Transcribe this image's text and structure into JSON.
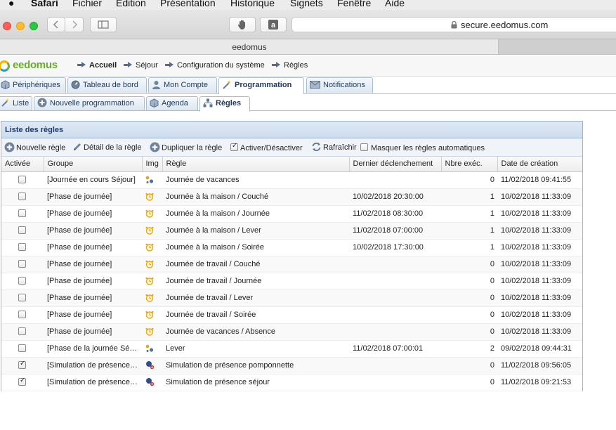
{
  "menubar": {
    "items": [
      "Safari",
      "Fichier",
      "Edition",
      "Présentation",
      "Historique",
      "Signets",
      "Fenêtre",
      "Aide"
    ]
  },
  "browser": {
    "url": "secure.eedomus.com",
    "tab_title": "eedomus"
  },
  "app": {
    "logo_text": "eedomus",
    "breadcrumb": [
      "Accueil",
      "Séjour",
      "Configuration du système",
      "Règles"
    ]
  },
  "main_tabs": [
    "Périphériques",
    "Tableau de bord",
    "Mon Compte",
    "Programmation",
    "Notifications"
  ],
  "sub_tabs": [
    "Liste",
    "Nouvelle programmation",
    "Agenda",
    "Règles"
  ],
  "panel": {
    "title": "Liste des règles",
    "tools": {
      "new_rule": "Nouvelle règle",
      "rule_detail": "Détail de la règle",
      "duplicate": "Dupliquer la règle",
      "activate": "Activer/Désactiver",
      "refresh": "Rafraîchir",
      "hide_auto": "Masquer les règles automatiques"
    },
    "columns": [
      "Activée",
      "Groupe",
      "Img",
      "Règle",
      "Dernier déclenchement",
      "Nbre exéc.",
      "Date de création"
    ],
    "rows": [
      {
        "active": false,
        "group": "[Journée en cours Séjour]",
        "icon": "rule-icon",
        "rule": "Journée de vacances",
        "last": "",
        "count": "0",
        "created": "11/02/2018 09:41:55"
      },
      {
        "active": false,
        "group": "[Phase de journée]",
        "icon": "alarm-clock-icon",
        "rule": "Journée à la maison / Couché",
        "last": "10/02/2018 20:30:00",
        "count": "1",
        "created": "10/02/2018 11:33:09"
      },
      {
        "active": false,
        "group": "[Phase de journée]",
        "icon": "alarm-clock-icon",
        "rule": "Journée à la maison / Journée",
        "last": "11/02/2018 08:30:00",
        "count": "1",
        "created": "10/02/2018 11:33:09"
      },
      {
        "active": false,
        "group": "[Phase de journée]",
        "icon": "alarm-clock-icon",
        "rule": "Journée à la maison / Lever",
        "last": "11/02/2018 07:00:00",
        "count": "1",
        "created": "10/02/2018 11:33:09"
      },
      {
        "active": false,
        "group": "[Phase de journée]",
        "icon": "alarm-clock-icon",
        "rule": "Journée à la maison / Soirée",
        "last": "10/02/2018 17:30:00",
        "count": "1",
        "created": "10/02/2018 11:33:09"
      },
      {
        "active": false,
        "group": "[Phase de journée]",
        "icon": "alarm-clock-icon",
        "rule": "Journée de travail / Couché",
        "last": "",
        "count": "0",
        "created": "10/02/2018 11:33:09"
      },
      {
        "active": false,
        "group": "[Phase de journée]",
        "icon": "alarm-clock-icon",
        "rule": "Journée de travail / Journée",
        "last": "",
        "count": "0",
        "created": "10/02/2018 11:33:09"
      },
      {
        "active": false,
        "group": "[Phase de journée]",
        "icon": "alarm-clock-icon",
        "rule": "Journée de travail / Lever",
        "last": "",
        "count": "0",
        "created": "10/02/2018 11:33:09"
      },
      {
        "active": false,
        "group": "[Phase de journée]",
        "icon": "alarm-clock-icon",
        "rule": "Journée de travail / Soirée",
        "last": "",
        "count": "0",
        "created": "10/02/2018 11:33:09"
      },
      {
        "active": false,
        "group": "[Phase de journée]",
        "icon": "alarm-clock-icon",
        "rule": "Journée de vacances / Absence",
        "last": "",
        "count": "0",
        "created": "10/02/2018 11:33:09"
      },
      {
        "active": false,
        "group": "[Phase de la journée Sé…",
        "icon": "rule-icon",
        "rule": "Lever",
        "last": "11/02/2018 07:00:01",
        "count": "2",
        "created": "09/02/2018 09:44:31"
      },
      {
        "active": true,
        "group": "[Simulation de présence…",
        "icon": "presence-icon",
        "rule": "Simulation de présence pomponnette",
        "last": "",
        "count": "0",
        "created": "11/02/2018 09:56:05"
      },
      {
        "active": true,
        "group": "[Simulation de présence…",
        "icon": "presence-icon",
        "rule": "Simulation de présence séjour",
        "last": "",
        "count": "0",
        "created": "11/02/2018 09:21:53"
      }
    ]
  },
  "colors": {
    "panel_border": "#9db6d0",
    "tab_text": "#1f3a5c",
    "logo_green": "#6aab2e",
    "alarm_orange": "#f2a20c"
  }
}
